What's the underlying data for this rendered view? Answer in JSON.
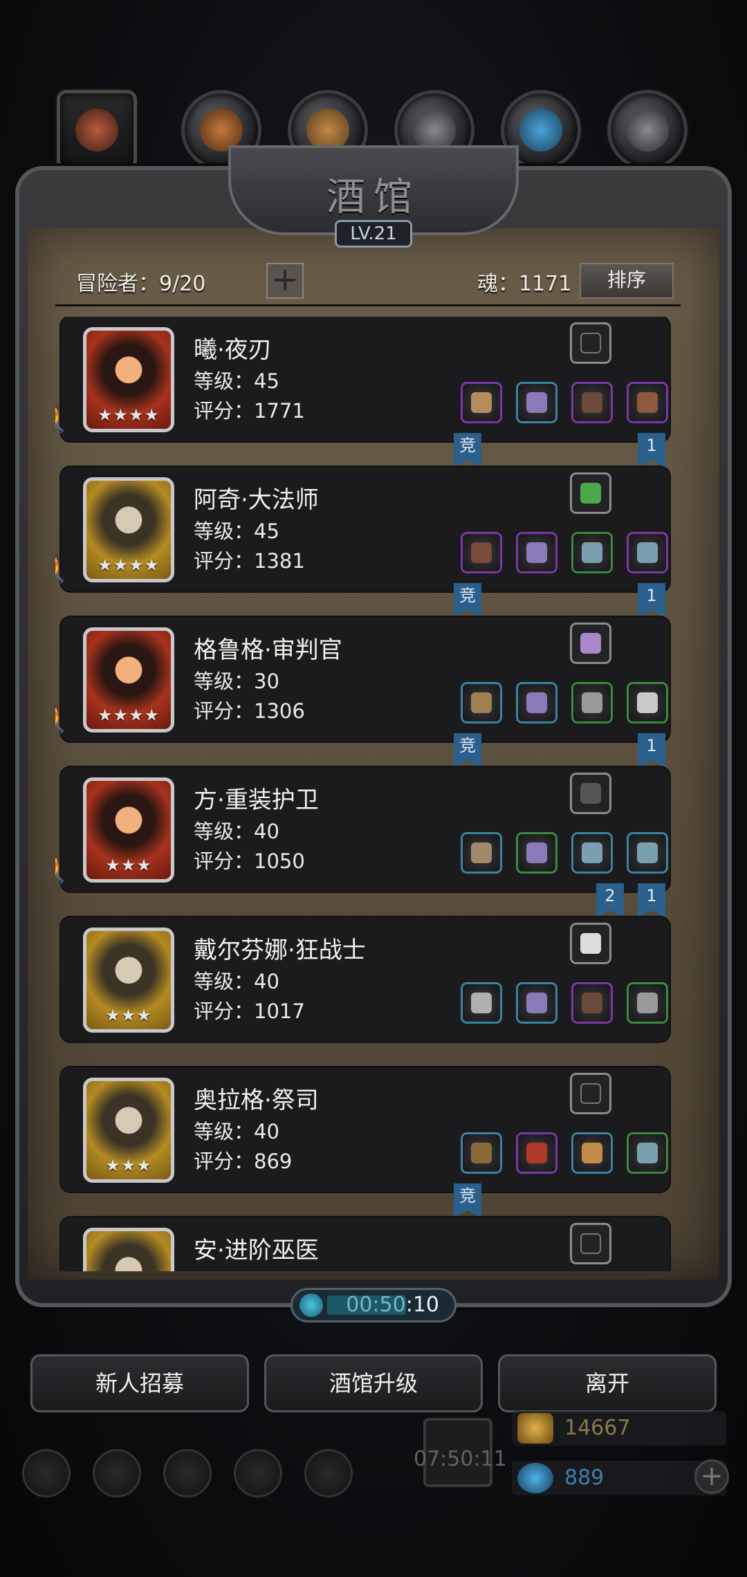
{
  "header": {
    "title": "酒馆",
    "level": "LV.21",
    "adventurers": "冒险者：9/20",
    "souls": "魂：1171",
    "sort_label": "排序"
  },
  "heroes": [
    {
      "name": "曦·夜刃",
      "level": "等级：45",
      "score": "评分：1771",
      "stars": "★★★★",
      "frame": "red",
      "equip": [
        {
          "color": "purple",
          "icon": "dagger-icon"
        },
        {
          "color": "blue",
          "icon": "armor-icon"
        },
        {
          "color": "purple",
          "icon": "cloak-icon"
        },
        {
          "color": "purple",
          "icon": "bracer-icon"
        }
      ],
      "accessory": "empty",
      "banners": [
        "竞",
        "1"
      ]
    },
    {
      "name": "阿奇·大法师",
      "level": "等级：45",
      "score": "评分：1381",
      "stars": "★★★★",
      "frame": "gold",
      "equip": [
        {
          "color": "purple",
          "icon": "staff-icon"
        },
        {
          "color": "purple",
          "icon": "armor-icon"
        },
        {
          "color": "green",
          "icon": "ring-icon"
        },
        {
          "color": "purple",
          "icon": "ring-icon"
        }
      ],
      "accessory": "green-book",
      "banners": [
        "竞",
        "1"
      ]
    },
    {
      "name": "格鲁格·审判官",
      "level": "等级：30",
      "score": "评分：1306",
      "stars": "★★★★",
      "frame": "red",
      "equip": [
        {
          "color": "blue",
          "icon": "hammer-icon"
        },
        {
          "color": "blue",
          "icon": "armor-icon"
        },
        {
          "color": "green",
          "icon": "gauntlet-icon"
        },
        {
          "color": "green",
          "icon": "amulet-icon"
        }
      ],
      "accessory": "crystal",
      "banners": [
        "竞",
        "1"
      ]
    },
    {
      "name": "方·重装护卫",
      "level": "等级：40",
      "score": "评分：1050",
      "stars": "★★★",
      "frame": "red",
      "equip": [
        {
          "color": "blue",
          "icon": "sword-icon"
        },
        {
          "color": "green",
          "icon": "armor-icon"
        },
        {
          "color": "blue",
          "icon": "ring-icon"
        },
        {
          "color": "blue",
          "icon": "ring-icon"
        }
      ],
      "accessory": "claw",
      "banners": [
        "2",
        "1"
      ]
    },
    {
      "name": "戴尔芬娜·狂战士",
      "level": "等级：40",
      "score": "评分：1017",
      "stars": "★★★",
      "frame": "gold",
      "equip": [
        {
          "color": "blue",
          "icon": "axe-icon"
        },
        {
          "color": "blue",
          "icon": "armor-icon"
        },
        {
          "color": "purple",
          "icon": "cloak-icon"
        },
        {
          "color": "green",
          "icon": "gauntlet-icon"
        }
      ],
      "accessory": "feather",
      "banners": []
    },
    {
      "name": "奥拉格·祭司",
      "level": "等级：40",
      "score": "评分：869",
      "stars": "★★★",
      "frame": "gold",
      "equip": [
        {
          "color": "blue",
          "icon": "mace-icon"
        },
        {
          "color": "purple",
          "icon": "robe-icon"
        },
        {
          "color": "blue",
          "icon": "scroll-icon"
        },
        {
          "color": "green",
          "icon": "ring-icon"
        }
      ],
      "accessory": "empty",
      "banners": [
        "竞"
      ]
    },
    {
      "name": "安·进阶巫医",
      "level": "",
      "score": "",
      "stars": "",
      "frame": "gold",
      "equip": [],
      "accessory": "empty",
      "banners": []
    }
  ],
  "timer": "00:50:10",
  "buttons": {
    "recruit": "新人招募",
    "upgrade": "酒馆升级",
    "leave": "离开"
  },
  "resources": {
    "gold": "14667",
    "gems": "889"
  },
  "gift_timer": "07:50:11"
}
